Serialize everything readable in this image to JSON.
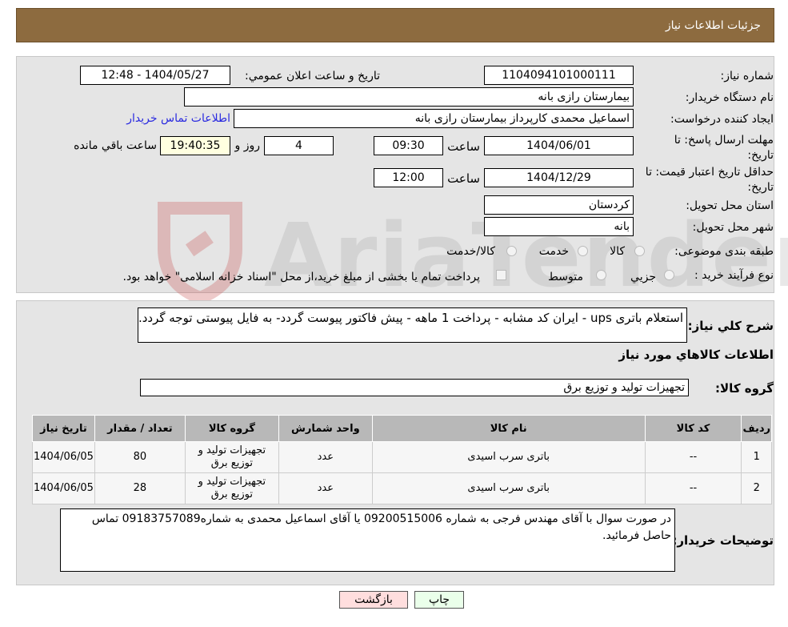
{
  "header": {
    "title": "جزئیات اطلاعات نیاز"
  },
  "watermark": "AriaTender.neT",
  "form": {
    "need_number_label": "شماره نیاز:",
    "need_number": "1104094101000111",
    "announce_label": "تاریخ و ساعت اعلان عمومي:",
    "announce_value": "1404/05/27 - 12:48",
    "buyer_org_label": "نام دستگاه خریدار:",
    "buyer_org": "بیمارستان رازی بانه",
    "creator_label": "ایجاد کننده درخواست:",
    "creator": "اسماعیل محمدی کارپرداز بیمارستان رازی بانه",
    "contact_link": "اطلاعات تماس خریدار",
    "reply_deadline_label": "مهلت ارسال پاسخ: تا تاریخ:",
    "reply_date": "1404/06/01",
    "time_label": "ساعت",
    "reply_time": "09:30",
    "days": "4",
    "days_label": "روز و",
    "remaining_time": "19:40:35",
    "remaining_label": "ساعت باقي مانده",
    "price_validity_label": "حداقل تاریخ اعتبار قیمت: تا تاریخ:",
    "price_date": "1404/12/29",
    "price_time": "12:00",
    "province_label": "استان محل تحویل:",
    "province": "کردستان",
    "city_label": "شهر محل تحویل:",
    "city": "بانه",
    "category_label": "طبقه بندی موضوعی:",
    "category_options": [
      "کالا",
      "خدمت",
      "کالا/خدمت"
    ],
    "process_label": "نوع فرآیند خرید :",
    "process_options": [
      "جزيي",
      "متوسط"
    ],
    "process_note": "پرداخت تمام یا بخشی از مبلغ خرید،از محل \"اسناد خزانه اسلامی\" خواهد بود."
  },
  "details": {
    "description_label": "شرح کلي نیاز:",
    "description": "استعلام باتری ups - ایران کد مشابه - پرداخت 1 ماهه - پیش فاکتور پیوست گردد- به فایل پیوستی توجه گردد.",
    "goods_info_title": "اطلاعات کالاهاي مورد نیاز",
    "goods_group_label": "گروه کالا:",
    "goods_group": "تجهیزات تولید و توزیع برق",
    "table": {
      "headers": [
        "ردیف",
        "کد کالا",
        "نام کالا",
        "واحد شمارش",
        "گروه کالا",
        "تعداد / مقدار",
        "تاریخ نیاز"
      ],
      "rows": [
        [
          "1",
          "--",
          "باتری سرب اسیدی",
          "عدد",
          "تجهیزات تولید و توزیع برق",
          "80",
          "1404/06/05"
        ],
        [
          "2",
          "--",
          "باتری سرب اسیدی",
          "عدد",
          "تجهیزات تولید و توزیع برق",
          "28",
          "1404/06/05"
        ]
      ]
    },
    "buyer_notes_label": "توضیحات خریدار:",
    "buyer_notes": "در صورت سوال با آقای مهندس فرجی به شماره 09200515006 یا آقای اسماعیل محمدی  به شماره09183757089 تماس حاصل فرمائید."
  },
  "buttons": {
    "print": "چاپ",
    "back": "بازگشت"
  }
}
